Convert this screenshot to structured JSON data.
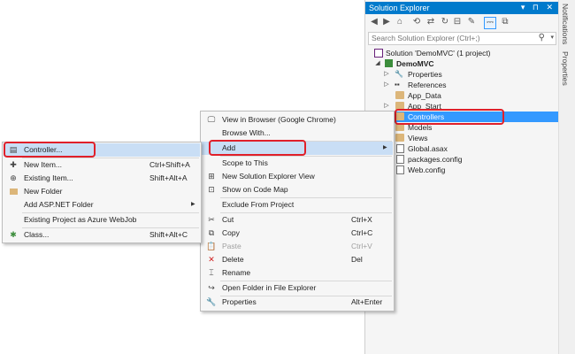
{
  "solution_explorer": {
    "title": "Solution Explorer",
    "title_controls": "▾ ⊓ ✕",
    "search_placeholder": "Search Solution Explorer (Ctrl+;)",
    "toolbar": [
      "back-icon",
      "forward-icon",
      "home-icon",
      "history-icon",
      "sync-icon",
      "refresh-icon",
      "collapse-icon",
      "properties-icon",
      "show-all-icon",
      "preview-icon"
    ],
    "tree": [
      {
        "label": "Solution 'DemoMVC' (1 project)",
        "icon": "solution-icon"
      },
      {
        "label": "DemoMVC",
        "icon": "project-icon",
        "expander": "◢"
      },
      {
        "label": "Properties",
        "icon": "wrench-icon",
        "expander": "▷"
      },
      {
        "label": "References",
        "icon": "references-icon",
        "expander": "▷"
      },
      {
        "label": "App_Data",
        "icon": "folder-icon"
      },
      {
        "label": "App_Start",
        "icon": "folder-icon",
        "expander": "▷"
      },
      {
        "label": "Controllers",
        "icon": "folder-icon"
      },
      {
        "label": "Models",
        "icon": "folder-icon"
      },
      {
        "label": "Views",
        "icon": "folder-icon"
      },
      {
        "label": "Global.asax",
        "icon": "file-icon"
      },
      {
        "label": "packages.config",
        "icon": "config-icon"
      },
      {
        "label": "Web.config",
        "icon": "config-icon"
      }
    ]
  },
  "side_tabs": [
    "Notifications",
    "Properties"
  ],
  "context_menu": {
    "items": [
      {
        "label": "View in Browser (Google Chrome)",
        "icon": "browser-icon"
      },
      {
        "label": "Browse With...",
        "icon": ""
      },
      {
        "label": "Add",
        "icon": "",
        "submenu": "▶"
      },
      {
        "label": "Scope to This",
        "icon": ""
      },
      {
        "label": "New Solution Explorer View",
        "icon": "new-view-icon"
      },
      {
        "label": "Show on Code Map",
        "icon": "code-map-icon"
      },
      {
        "label": "Exclude From Project",
        "icon": ""
      },
      {
        "label": "Cut",
        "icon": "scissors-icon",
        "shortcut": "Ctrl+X"
      },
      {
        "label": "Copy",
        "icon": "copy-icon",
        "shortcut": "Ctrl+C"
      },
      {
        "label": "Paste",
        "icon": "paste-icon",
        "shortcut": "Ctrl+V",
        "disabled": true
      },
      {
        "label": "Delete",
        "icon": "delete-icon",
        "shortcut": "Del"
      },
      {
        "label": "Rename",
        "icon": "rename-icon"
      },
      {
        "label": "Open Folder in File Explorer",
        "icon": "open-folder-icon"
      },
      {
        "label": "Properties",
        "icon": "wrench-icon",
        "shortcut": "Alt+Enter"
      }
    ]
  },
  "add_submenu": {
    "items": [
      {
        "label": "Controller...",
        "icon": "controller-icon"
      },
      {
        "label": "New Item...",
        "icon": "new-item-icon",
        "shortcut": "Ctrl+Shift+A"
      },
      {
        "label": "Existing Item...",
        "icon": "existing-item-icon",
        "shortcut": "Shift+Alt+A"
      },
      {
        "label": "New Folder",
        "icon": "new-folder-icon"
      },
      {
        "label": "Add ASP.NET Folder",
        "icon": "",
        "submenu": "▶"
      },
      {
        "label": "Existing Project as Azure WebJob",
        "icon": ""
      },
      {
        "label": "Class...",
        "icon": "class-icon",
        "shortcut": "Shift+Alt+C"
      }
    ]
  },
  "colors": {
    "accent": "#007acc",
    "selection": "#3399ff",
    "menu_highlight": "#c9def5",
    "callout": "#e0202a",
    "folder": "#dcb67a"
  }
}
